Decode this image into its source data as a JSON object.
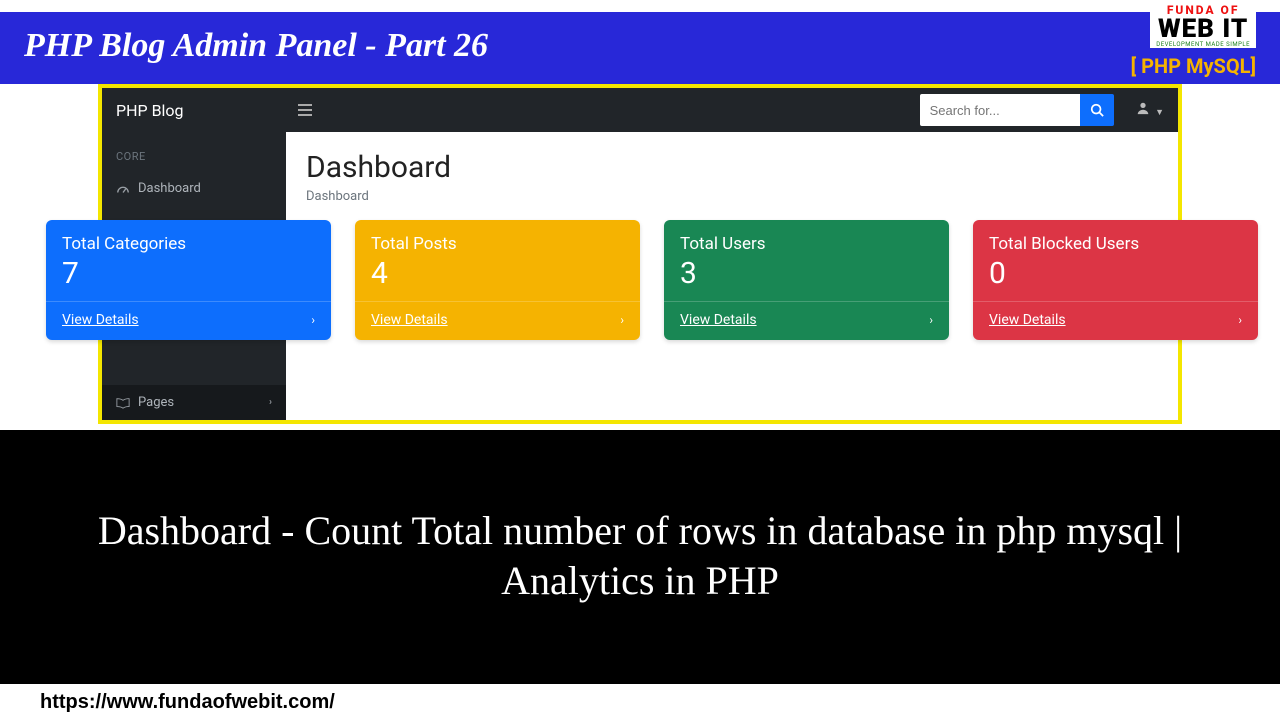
{
  "header": {
    "title": "PHP Blog Admin Panel - Part 26",
    "logo_top": "FUNDA OF",
    "logo_main": "WEB IT",
    "logo_sub": "DEVELOPMENT MADE SIMPLE",
    "tagline": "[ PHP MySQL]"
  },
  "admin": {
    "brand": "PHP Blog",
    "search_placeholder": "Search for...",
    "sidebar": {
      "section_core": "CORE",
      "dashboard": "Dashboard",
      "pages": "Pages"
    },
    "main": {
      "title": "Dashboard",
      "breadcrumb": "Dashboard"
    }
  },
  "cards": [
    {
      "title": "Total Categories",
      "value": "7",
      "link": "View Details",
      "color": "c-blue"
    },
    {
      "title": "Total Posts",
      "value": "4",
      "link": "View Details",
      "color": "c-yellow"
    },
    {
      "title": "Total Users",
      "value": "3",
      "link": "View Details",
      "color": "c-green"
    },
    {
      "title": "Total Blocked Users",
      "value": "0",
      "link": "View Details",
      "color": "c-red"
    }
  ],
  "caption": "Dashboard - Count Total number of rows in database in php mysql | Analytics in PHP",
  "footer_url": "https://www.fundaofwebit.com/"
}
